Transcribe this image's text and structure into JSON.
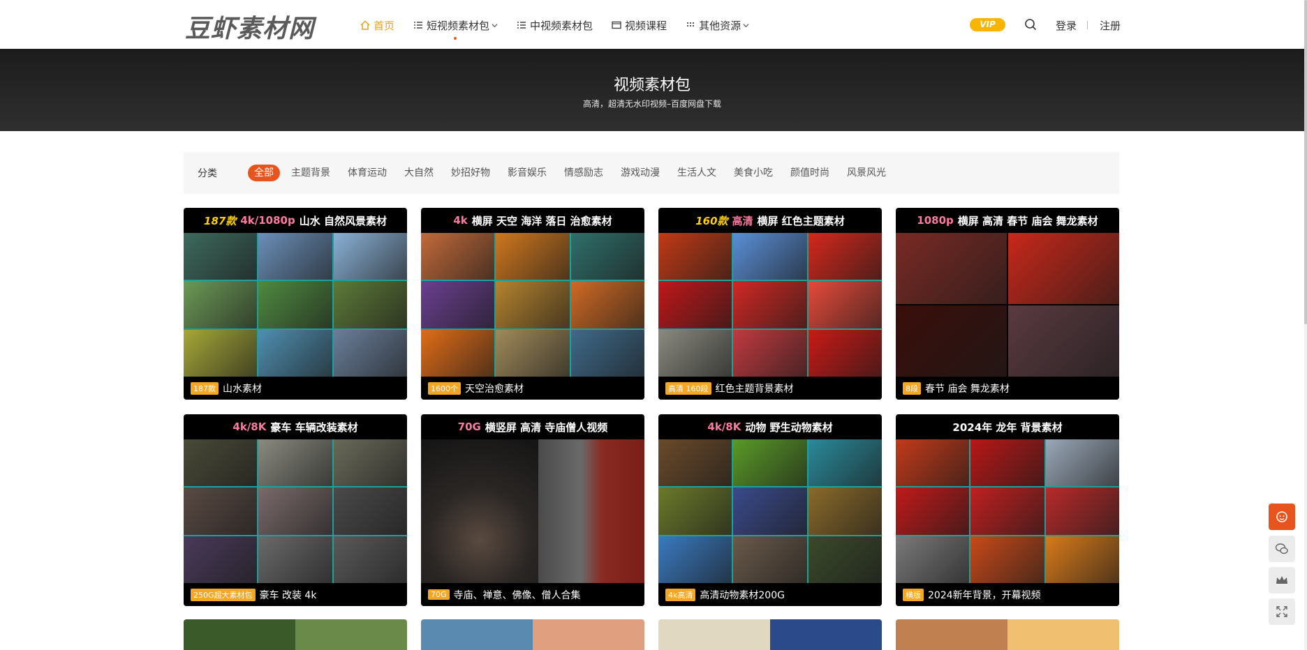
{
  "header": {
    "logo": "豆虾素材网",
    "nav": [
      {
        "label": "首页",
        "icon": "home-icon",
        "active": true
      },
      {
        "label": "短视频素材包",
        "icon": "list-icon",
        "dropdown": true
      },
      {
        "label": "中视频素材包",
        "icon": "list-icon"
      },
      {
        "label": "视频课程",
        "icon": "video-icon"
      },
      {
        "label": "其他资源",
        "icon": "grid-icon",
        "dropdown": true
      }
    ],
    "vip": "VIP",
    "login": "登录",
    "register": "注册"
  },
  "banner": {
    "title": "视频素材包",
    "subtitle": "高清，超清无水印视频–百度网盘下载"
  },
  "filter": {
    "label": "分类",
    "chips": [
      "全部",
      "主题背景",
      "体育运动",
      "大自然",
      "妙招好物",
      "影音娱乐",
      "情感励志",
      "游戏动漫",
      "生活人文",
      "美食小吃",
      "颜值时尚",
      "风景风光"
    ],
    "active_index": 0
  },
  "cards": [
    {
      "head_hl": "187款",
      "head_hl2": "4k/1080p",
      "head_text": "山水 自然风景素材",
      "tag": "187款",
      "title": "山水素材",
      "layout": "grid3",
      "colors": [
        "#3d6a5e",
        "#6b8fb8",
        "#8ab1d6",
        "#6c9a56",
        "#4f8a40",
        "#5d7a38",
        "#a6a838",
        "#4f8fb0",
        "#6a7f9a"
      ]
    },
    {
      "head_hl": "4k",
      "head_hl2": "",
      "head_text": "横屏 天空 海洋 落日 治愈素材",
      "tag": "1600个",
      "title": "天空治愈素材",
      "layout": "grid3",
      "colors": [
        "#c26a3a",
        "#d0781e",
        "#2f6f6a",
        "#6a3f8f",
        "#b5832e",
        "#d06a24",
        "#e06c18",
        "#a08a5a",
        "#3f6a8a"
      ]
    },
    {
      "head_hl": "160款",
      "head_hl2": "高清",
      "head_text": "横屏 红色主题素材",
      "tag": "高清 160段",
      "title": "红色主题背景素材",
      "layout": "grid3",
      "colors": [
        "#c23a16",
        "#5a8fd6",
        "#d4281c",
        "#c0181a",
        "#d02824",
        "#e64a3a",
        "#8a8a80",
        "#c03a40",
        "#c81a16"
      ]
    },
    {
      "head_hl": "1080p",
      "head_hl2": "",
      "head_text": "横屏 高清 春节 庙会 舞龙素材",
      "tag": "8段",
      "title": "春节 庙会 舞龙素材",
      "layout": "grid2",
      "colors": [
        "#7a2a24",
        "#c8281a",
        "#3a0e0a",
        "#5a3a40"
      ]
    },
    {
      "head_hl": "4k/8K",
      "head_hl2": "",
      "head_text": "豪车 车辆改装素材",
      "tag": "250G超大素材包",
      "title": "豪车 改装 4k",
      "layout": "grid3",
      "colors": [
        "#4a4a38",
        "#8a8a80",
        "#6a6a5a",
        "#5a4a44",
        "#7a6a6a",
        "#4a4a4a",
        "#4a3a5a",
        "#6a6a6a",
        "#5a5a5a"
      ]
    },
    {
      "head_hl": "70G",
      "head_hl2": "",
      "head_text": "横竖屏 高清 寺庙僧人视频",
      "tag": "70G",
      "title": "寺庙、禅意、佛像、僧人合集",
      "layout": "split",
      "colors": [
        "#3a3a3a",
        "#8a3028"
      ]
    },
    {
      "head_hl": "4k/8K",
      "head_hl2": "",
      "head_text": "动物 野生动物素材",
      "tag": "4k高清",
      "title": "高清动物素材200G",
      "layout": "grid3",
      "colors": [
        "#6a4a2a",
        "#5a9a28",
        "#2a8a9a",
        "#6a7a2a",
        "#3a4a8a",
        "#8a6a2a",
        "#3a7ac0",
        "#6a5a4a",
        "#3a4a2a"
      ]
    },
    {
      "head_hl": "",
      "head_hl2": "",
      "head_text": "2024年 龙年 背景素材",
      "tag": "横版",
      "title": "2024新年背景，开幕视频",
      "layout": "grid3",
      "colors": [
        "#c23a1a",
        "#b81818",
        "#9aa8b8",
        "#c01a1a",
        "#c02020",
        "#b82a2a",
        "#7a7a7a",
        "#c84a1a",
        "#d87a1a"
      ]
    }
  ],
  "partial_cards": [
    {
      "colors": [
        "#3a5a2a",
        "#6a8a4a"
      ]
    },
    {
      "colors": [
        "#5a8ab0",
        "#e0a080"
      ]
    },
    {
      "colors": [
        "#e0d8c0",
        "#2a4a8a"
      ]
    },
    {
      "colors": [
        "#c08050",
        "#f0c070"
      ]
    }
  ],
  "side_buttons": [
    "customer-service-icon",
    "wechat-icon",
    "crown-icon",
    "fullscreen-icon"
  ]
}
